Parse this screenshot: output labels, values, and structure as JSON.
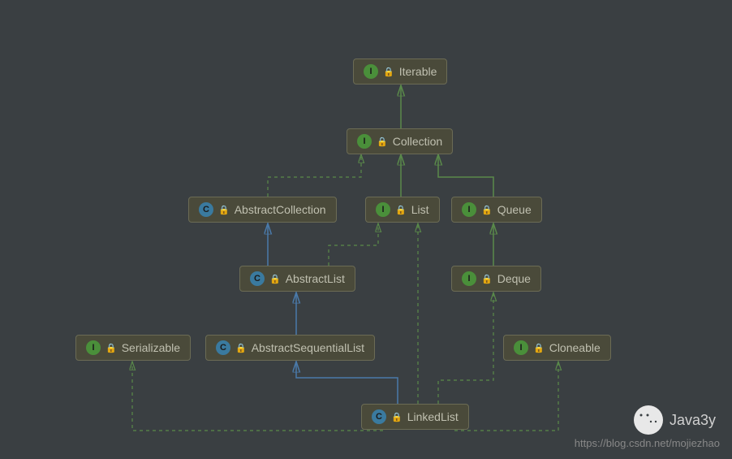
{
  "nodes": {
    "iterable": {
      "label": "Iterable",
      "type": "I"
    },
    "collection": {
      "label": "Collection",
      "type": "I"
    },
    "abscoll": {
      "label": "AbstractCollection",
      "type": "C"
    },
    "list": {
      "label": "List",
      "type": "I"
    },
    "queue": {
      "label": "Queue",
      "type": "I"
    },
    "abslist": {
      "label": "AbstractList",
      "type": "C"
    },
    "deque": {
      "label": "Deque",
      "type": "I"
    },
    "serializable": {
      "label": "Serializable",
      "type": "I"
    },
    "absseqlist": {
      "label": "AbstractSequentialList",
      "type": "C"
    },
    "cloneable": {
      "label": "Cloneable",
      "type": "I"
    },
    "linkedlist": {
      "label": "LinkedList",
      "type": "C"
    }
  },
  "watermark": {
    "label": "Java3y"
  },
  "url": "https://blog.csdn.net/mojiezhao"
}
